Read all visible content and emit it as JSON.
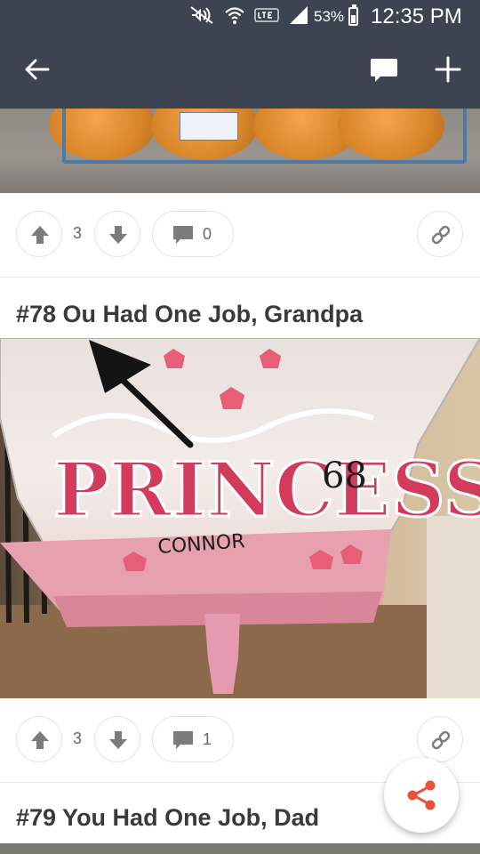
{
  "status_bar": {
    "battery_percent": "53%",
    "time": "12:35 PM",
    "icons": [
      "mute-icon",
      "wifi-icon",
      "lte-icon",
      "signal-icon",
      "battery-icon"
    ]
  },
  "app_bar": {
    "back_icon": "arrow-left-icon",
    "comment_icon": "comment-icon",
    "add_icon": "plus-icon"
  },
  "posts": [
    {
      "image": "Oranges in a plastic tray",
      "upvotes": "3",
      "comments": "0"
    },
    {
      "title": "#78 Ou Had One Job, Grandpa",
      "image": "Princess balloon",
      "image_text": [
        "PRINCESS",
        "CONNOR",
        "68"
      ],
      "upvotes": "3",
      "comments": "1"
    },
    {
      "title": "#79 You Had One Job, Dad"
    }
  ],
  "colors": {
    "app_bar": "#3b4450",
    "title_text": "#3a3a3a",
    "icon_gray": "#7b7b7b",
    "share_accent": "#e8513a"
  },
  "share_icon": "share-icon"
}
